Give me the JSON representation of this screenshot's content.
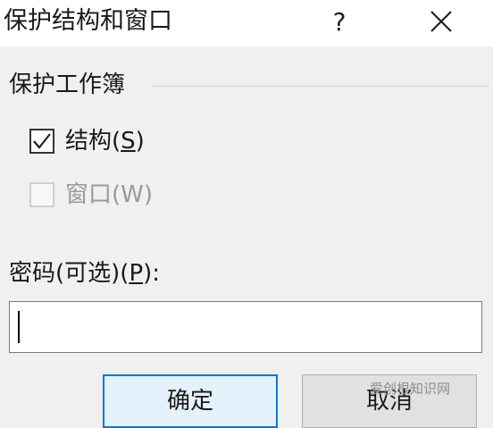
{
  "window": {
    "title": "保护结构和窗口",
    "help_label": "?"
  },
  "group": {
    "label": "保护工作簿"
  },
  "options": {
    "structure": {
      "label_before": "结构(",
      "accel": "S",
      "label_after": ")",
      "checked": true,
      "enabled": true
    },
    "windows": {
      "label": "窗口(W)",
      "checked": false,
      "enabled": false
    }
  },
  "password": {
    "label_before": "密码(可选)(",
    "accel": "P",
    "label_after": "):",
    "value": ""
  },
  "buttons": {
    "ok_label": "确定",
    "cancel_label": "取消"
  },
  "watermark": "爱创根知识网",
  "colors": {
    "accent": "#0078d7",
    "background": "#f0f0f0",
    "titlebar": "#ffffff"
  }
}
